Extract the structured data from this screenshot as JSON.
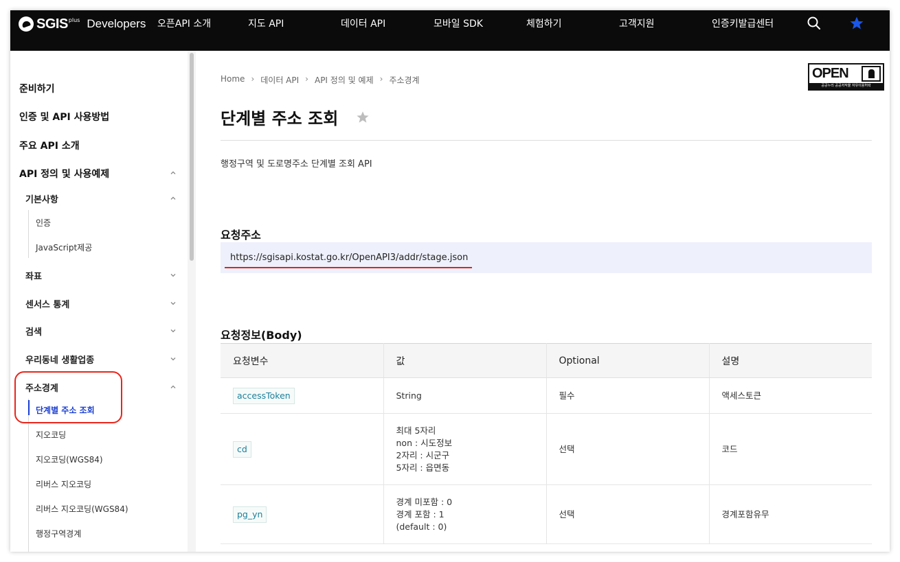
{
  "header": {
    "logo_text": "SGIS",
    "logo_sup": "plus",
    "logo_suffix": "Developers",
    "nav": [
      "오픈API 소개",
      "지도 API",
      "데이터 API",
      "모바일 SDK",
      "체험하기",
      "고객지원",
      "인증키발급센터"
    ],
    "icons": [
      "search-icon",
      "star-icon"
    ],
    "accent_color": "#1a56e8"
  },
  "sidebar": {
    "items": [
      {
        "label": "준비하기",
        "level": 1
      },
      {
        "label": "인증 및 API 사용방법",
        "level": 1
      },
      {
        "label": "주요 API 소개",
        "level": 1
      },
      {
        "label": "API 정의 및 사용예제",
        "level": 1,
        "expanded": true
      },
      {
        "label": "기본사항",
        "level": 2,
        "expanded": true
      },
      {
        "label": "인증",
        "level": 3
      },
      {
        "label": "JavaScript제공",
        "level": 3
      },
      {
        "label": "좌표",
        "level": 2,
        "expanded": false
      },
      {
        "label": "센서스 통계",
        "level": 2,
        "expanded": false
      },
      {
        "label": "검색",
        "level": 2,
        "expanded": false
      },
      {
        "label": "우리동네 생활업종",
        "level": 2,
        "expanded": false
      },
      {
        "label": "주소경계",
        "level": 2,
        "expanded": true
      },
      {
        "label": "단계별 주소 조회",
        "level": 3,
        "active": true
      },
      {
        "label": "지오코딩",
        "level": 3
      },
      {
        "label": "지오코딩(WGS84)",
        "level": 3
      },
      {
        "label": "리버스 지오코딩",
        "level": 3
      },
      {
        "label": "리버스 지오코딩(WGS84)",
        "level": 3
      },
      {
        "label": "행정구역경계",
        "level": 3
      }
    ]
  },
  "main": {
    "breadcrumb": [
      "Home",
      "데이터 API",
      "API 정의 및 예제",
      "주소경계"
    ],
    "badge": {
      "label": "OPEN",
      "footer": "공공누리 공공저작물 자유이용허락"
    },
    "title": "단계별 주소 조회",
    "description": "행정구역 및 도로명주소 단계별 조회 API",
    "request_url_heading": "요청주소",
    "request_url": "https://sgisapi.kostat.go.kr/OpenAPI3/addr/stage.json",
    "request_body_heading": "요청정보(Body)",
    "table": {
      "headers": [
        "요청변수",
        "값",
        "Optional",
        "설명"
      ],
      "rows": [
        {
          "param": "accessToken",
          "value": [
            "String"
          ],
          "optional": "필수",
          "desc": "액세스토큰"
        },
        {
          "param": "cd",
          "value": [
            "최대 5자리",
            "non : 시도정보",
            "2자리 : 시군구",
            "5자리 : 읍면동"
          ],
          "optional": "선택",
          "desc": "코드"
        },
        {
          "param": "pg_yn",
          "value": [
            "경계 미포함 : 0",
            "경계 포함 : 1",
            "(default : 0)"
          ],
          "optional": "선택",
          "desc": "경계포함유무"
        }
      ]
    }
  }
}
